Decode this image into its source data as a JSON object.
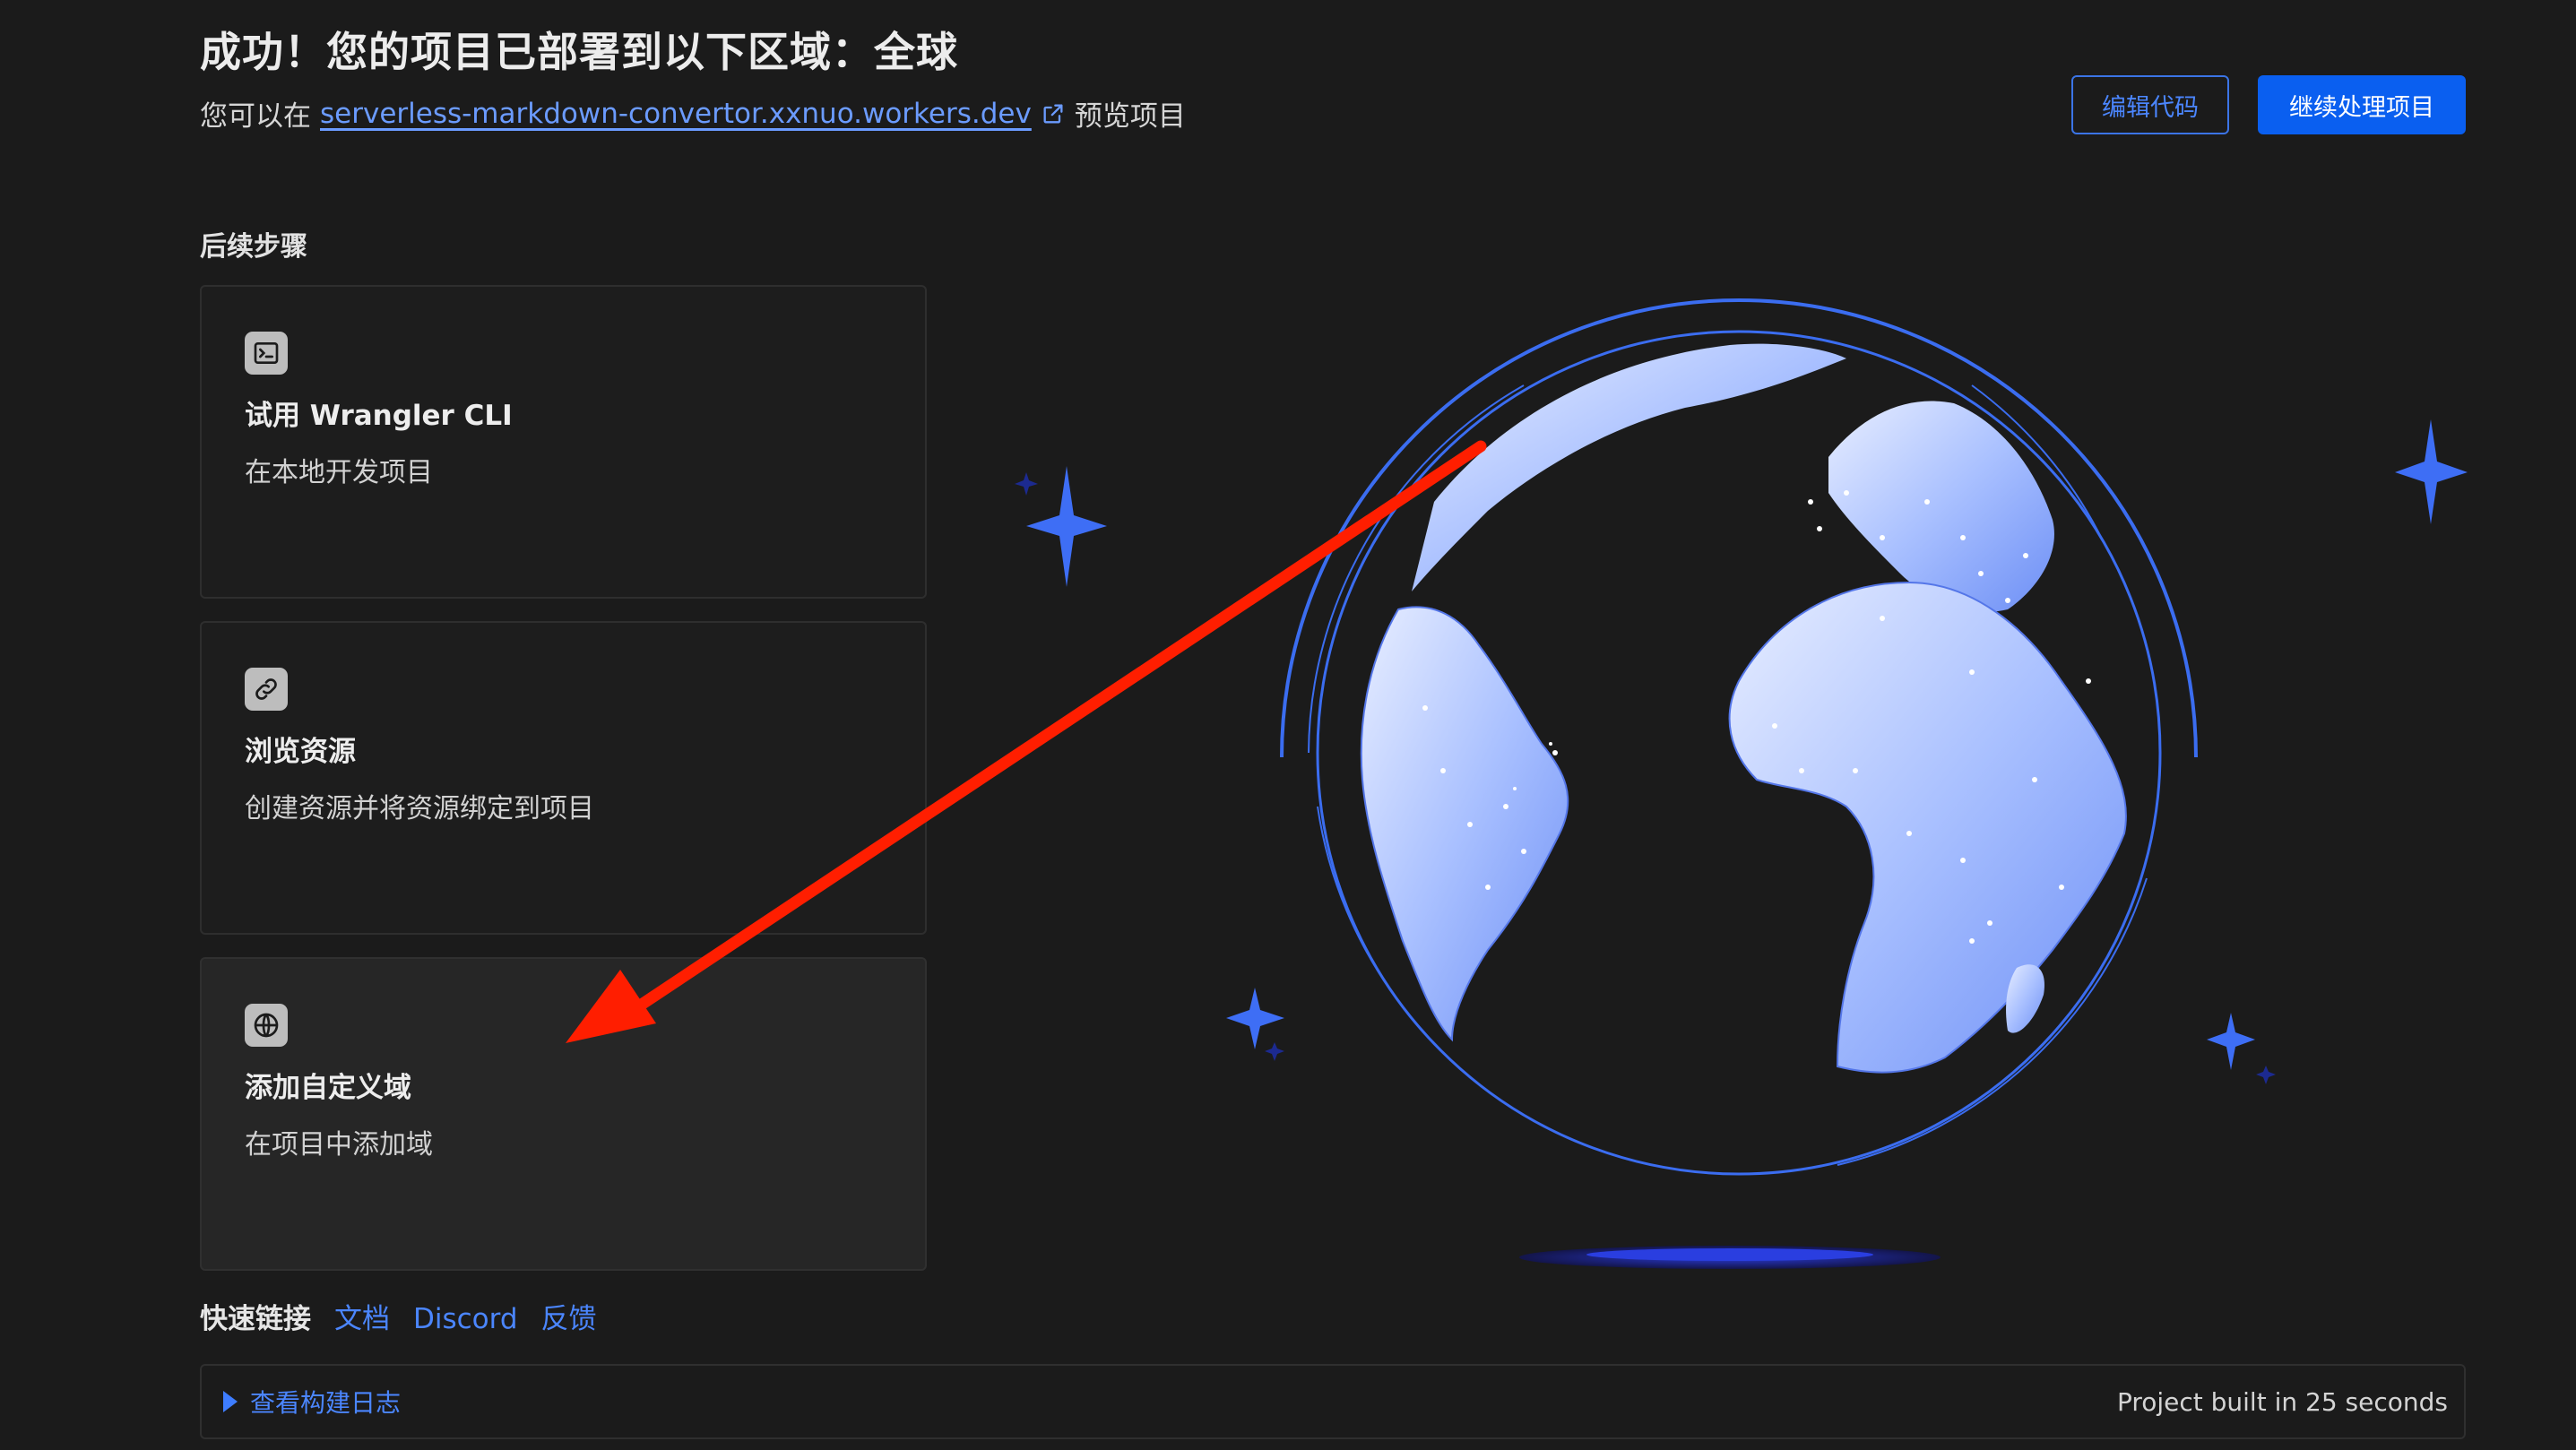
{
  "header": {
    "title": "成功！您的项目已部署到以下区域：全球",
    "subtitle_prefix": "您可以在",
    "url": "serverless-markdown-convertor.xxnuo.workers.dev",
    "subtitle_suffix": "预览项目",
    "edit_button": "编辑代码",
    "continue_button": "继续处理项目"
  },
  "next_steps": {
    "label": "后续步骤",
    "cards": [
      {
        "icon": "terminal-icon",
        "title": "试用 Wrangler CLI",
        "desc": "在本地开发项目"
      },
      {
        "icon": "link-icon",
        "title": "浏览资源",
        "desc": "创建资源并将资源绑定到项目"
      },
      {
        "icon": "globe-icon",
        "title": "添加自定义域",
        "desc": "在项目中添加域"
      }
    ]
  },
  "quick_links": {
    "label": "快速链接",
    "links": [
      "文档",
      "Discord",
      "反馈"
    ]
  },
  "build": {
    "toggle_label": "查看构建日志",
    "status": "Project built in 25 seconds"
  },
  "colors": {
    "accent": "#0a5ff0",
    "link": "#4b86ff",
    "background": "#1b1b1b",
    "annotation_arrow": "#ff1e00"
  }
}
